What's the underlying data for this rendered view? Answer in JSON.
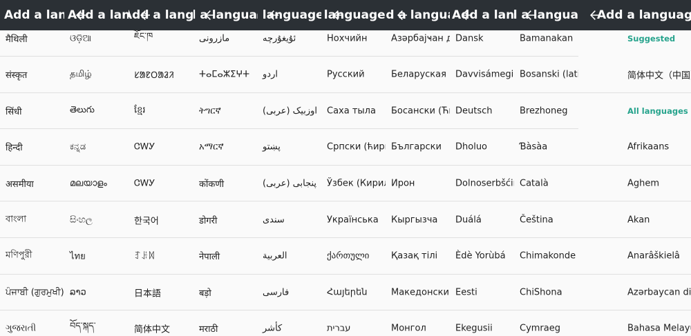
{
  "toolbar": {
    "title": "Add a language",
    "back_icon": "arrow-back-icon",
    "background": "#2b3035"
  },
  "colors": {
    "accent": "#26a38c",
    "row_divider": "#dfdfdf"
  },
  "panels": [
    {
      "title": "Add a language",
      "items": [
        "मैथिली",
        "संस्कृत",
        "सिंधी",
        "हिन्दी",
        "असमीया",
        "বাংলা",
        "মণিপুরী",
        "ਪੰਜਾਬੀ (ਗੁਰਮੁਖੀ)",
        "ગુજરાતી"
      ]
    },
    {
      "title": "Add a language",
      "items": [
        "ଓଡ଼ିଆ",
        "தமிழ்",
        "తెలుగు",
        "ಕನ್ನಡ",
        "മലയാളം",
        "සිංහල",
        "ไทย",
        "ລາວ",
        "བོད་སྐད་"
      ]
    },
    {
      "title": "Add a language",
      "items": [
        "ཇོང་ཁ",
        "ᱥᱟᱱᱛᱟᱲᱤ",
        "ខ្មែរ",
        "ᏣᎳᎩ",
        "ᏣᎳᎩ",
        "한국어",
        "ꆈꌠꉙ",
        "日本語",
        "简体中文"
      ]
    },
    {
      "title": "Add a language",
      "items": [
        "مازرونی",
        "ⵜⴰⵎⴰⵣⵉⵖⵜ",
        "ትግርኛ",
        "አማርኛ",
        "कोंकणी",
        "डोगरी",
        "नेपाली",
        "बड़ो",
        "मराठी"
      ]
    },
    {
      "title": "Add a language",
      "items": [
        "ئۇيغۇرچە",
        "اردو",
        "اوزبیک (عربی)",
        "پښتو",
        "پنجابی (عربی)",
        "سندی",
        "العربية",
        "فارسی",
        "کأشر"
      ]
    },
    {
      "title": "Add a language",
      "items": [
        "Нохчийн",
        "Русский",
        "Саха тыла",
        "Српски (ћирилица)",
        "Ўзбек (Кирил)",
        "Українська",
        "ქართული",
        "Հայերեն",
        "עברית"
      ]
    },
    {
      "title": "Add a language",
      "items": [
        "Азәрбајҹан дили (Кирил)",
        "Беларуская",
        "Босански (Ћирилица)",
        "Български",
        "Ирон",
        "Кыргызча",
        "Қазақ тілі",
        "Македонски",
        "Монгол"
      ]
    },
    {
      "title": "Add a language",
      "items": [
        "Dansk",
        "Davvisámegiella",
        "Deutsch",
        "Dholuo",
        "Dolnoserbšćina",
        "Duálá",
        "Èdè Yorùbá",
        "Eesti",
        "Ekegusii"
      ]
    },
    {
      "title": "Add a language",
      "items": [
        "Bamanakan",
        "Bosanski (latinica)",
        "Brezhoneg",
        "Ɓàsàa",
        "Català",
        "Čeština",
        "Chimakonde",
        "ChiShona",
        "Cymraeg"
      ]
    },
    {
      "title": "Add a language",
      "items": [
        "Suggested",
        "简体中文（中国）",
        "All languages",
        "Afrikaans",
        "Aghem",
        "Akan",
        "Anarâškielâ",
        "Azərbaycan dili",
        "Bahasa Melayu"
      ]
    }
  ]
}
